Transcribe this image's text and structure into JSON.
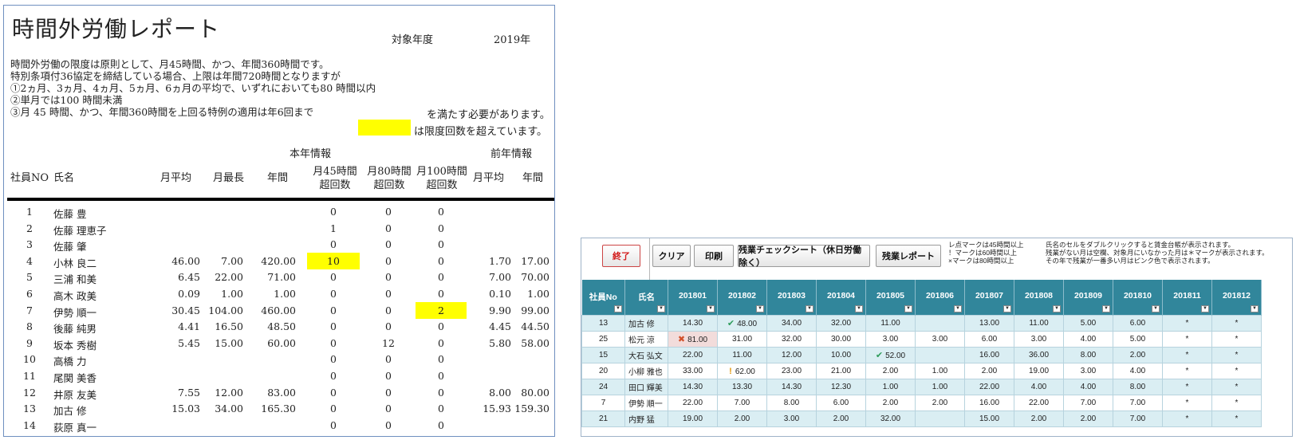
{
  "report": {
    "title": "時間外労働レポート",
    "year_label": "対象年度",
    "year": "2019年",
    "notes": [
      "時間外労働の限度は原則として、月45時間、かつ、年間360時間です。",
      "特別条項付36協定を締結している場合、上限は年間720時間となりますが",
      "①2ヵ月、3ヵ月、4ヵ月、5ヵ月、6ヵ月の平均で、いずれにおいても80 時間以内",
      "②単月では100 時間未満",
      "③月 45 時間、かつ、年間360時間を上回る特例の適用は年6回まで"
    ],
    "must_satisfy": "を満たす必要があります。",
    "over_limit_legend": "は限度回数を超えています。",
    "section_current": "本年情報",
    "section_previous": "前年情報",
    "headers": {
      "no": "社員NO",
      "name": "氏名",
      "avg": "月平均",
      "max": "月最長",
      "year": "年間",
      "m45_1": "月45時間",
      "m45_2": "超回数",
      "m80_1": "月80時間",
      "m80_2": "超回数",
      "m100_1": "月100時間",
      "m100_2": "超回数",
      "prev_avg": "月平均",
      "prev_year": "年間"
    },
    "rows": [
      {
        "no": "1",
        "name": "佐藤 豊",
        "avg": "",
        "max": "",
        "year": "",
        "m45": "0",
        "m80": "0",
        "m100": "0",
        "pavg": "",
        "pyr": ""
      },
      {
        "no": "2",
        "name": "佐藤 理恵子",
        "avg": "",
        "max": "",
        "year": "",
        "m45": "1",
        "m80": "0",
        "m100": "0",
        "pavg": "",
        "pyr": ""
      },
      {
        "no": "3",
        "name": "佐藤 肇",
        "avg": "",
        "max": "",
        "year": "",
        "m45": "0",
        "m80": "0",
        "m100": "0",
        "pavg": "",
        "pyr": ""
      },
      {
        "no": "4",
        "name": "小林 良二",
        "avg": "46.00",
        "max": "7.00",
        "year": "420.00",
        "m45": "10",
        "m80": "0",
        "m100": "0",
        "pavg": "1.70",
        "pyr": "17.00"
      },
      {
        "no": "5",
        "name": "三浦 和美",
        "avg": "6.45",
        "max": "22.00",
        "year": "71.00",
        "m45": "0",
        "m80": "0",
        "m100": "0",
        "pavg": "7.00",
        "pyr": "70.00"
      },
      {
        "no": "6",
        "name": "高木 政美",
        "avg": "0.09",
        "max": "1.00",
        "year": "1.00",
        "m45": "0",
        "m80": "0",
        "m100": "0",
        "pavg": "0.10",
        "pyr": "1.00"
      },
      {
        "no": "7",
        "name": "伊勢 順一",
        "avg": "30.45",
        "max": "104.00",
        "year": "460.00",
        "m45": "0",
        "m80": "0",
        "m100": "2",
        "pavg": "9.90",
        "pyr": "99.00"
      },
      {
        "no": "8",
        "name": "後藤 純男",
        "avg": "4.41",
        "max": "16.50",
        "year": "48.50",
        "m45": "0",
        "m80": "0",
        "m100": "0",
        "pavg": "4.45",
        "pyr": "44.50"
      },
      {
        "no": "9",
        "name": "坂本 秀樹",
        "avg": "5.45",
        "max": "15.00",
        "year": "60.00",
        "m45": "0",
        "m80": "12",
        "m100": "0",
        "pavg": "5.80",
        "pyr": "58.00"
      },
      {
        "no": "10",
        "name": "高橋 力",
        "avg": "",
        "max": "",
        "year": "",
        "m45": "0",
        "m80": "0",
        "m100": "0",
        "pavg": "",
        "pyr": ""
      },
      {
        "no": "11",
        "name": "尾関 美香",
        "avg": "",
        "max": "",
        "year": "",
        "m45": "0",
        "m80": "0",
        "m100": "0",
        "pavg": "",
        "pyr": ""
      },
      {
        "no": "12",
        "name": "井原 友美",
        "avg": "7.55",
        "max": "12.00",
        "year": "83.00",
        "m45": "0",
        "m80": "0",
        "m100": "0",
        "pavg": "8.00",
        "pyr": "80.00"
      },
      {
        "no": "13",
        "name": "加古 修",
        "avg": "15.03",
        "max": "34.00",
        "year": "165.30",
        "m45": "0",
        "m80": "0",
        "m100": "0",
        "pavg": "15.93",
        "pyr": "159.30"
      },
      {
        "no": "14",
        "name": "荻原 真一",
        "avg": "",
        "max": "",
        "year": "",
        "m45": "0",
        "m80": "0",
        "m100": "0",
        "pavg": "",
        "pyr": ""
      }
    ]
  },
  "app": {
    "buttons": {
      "exit": "終了",
      "clear": "クリア",
      "print": "印刷",
      "check_sheet": "残業チェックシート（休日労働除く）",
      "report": "残業レポート"
    },
    "legend_notes": [
      "レ点マークは45時間以上",
      "！マークは60時間以上",
      "×マークは80時間以上"
    ],
    "info_notes": [
      "氏名のセルをダブルクリックすると賃金台帳が表示されます。",
      "残業がない月は空欄、対象月にいなかった月は＊マークが表示されます。",
      "その年で残業が一番多い月はピンク色で表示されます。"
    ],
    "columns": [
      "社員No",
      "氏名",
      "201801",
      "201802",
      "201803",
      "201804",
      "201805",
      "201806",
      "201807",
      "201808",
      "201809",
      "201810",
      "201811",
      "201812"
    ],
    "rows": [
      {
        "no": "13",
        "name": "加古 修",
        "v": [
          "14.30",
          "48.00",
          "34.00",
          "32.00",
          "11.00",
          "",
          "13.00",
          "11.00",
          "5.00",
          "6.00",
          "*",
          "*"
        ]
      },
      {
        "no": "25",
        "name": "松元 涼",
        "v": [
          "81.00",
          "31.00",
          "32.00",
          "30.00",
          "3.00",
          "3.00",
          "6.00",
          "3.00",
          "4.00",
          "5.00",
          "*",
          "*"
        ]
      },
      {
        "no": "15",
        "name": "大石 弘文",
        "v": [
          "22.00",
          "11.00",
          "12.00",
          "10.00",
          "52.00",
          "",
          "16.00",
          "36.00",
          "8.00",
          "2.00",
          "*",
          "*"
        ]
      },
      {
        "no": "20",
        "name": "小柳 雅也",
        "v": [
          "33.00",
          "62.00",
          "23.00",
          "21.00",
          "2.00",
          "1.00",
          "2.00",
          "19.00",
          "3.00",
          "4.00",
          "*",
          "*"
        ]
      },
      {
        "no": "24",
        "name": "田口 輝美",
        "v": [
          "14.30",
          "13.30",
          "14.30",
          "12.30",
          "1.00",
          "1.00",
          "22.00",
          "4.00",
          "4.00",
          "8.00",
          "*",
          "*"
        ]
      },
      {
        "no": "7",
        "name": "伊勢 順一",
        "v": [
          "22.00",
          "7.00",
          "8.00",
          "6.00",
          "2.00",
          "2.00",
          "16.00",
          "22.00",
          "7.00",
          "7.00",
          "*",
          "*"
        ]
      },
      {
        "no": "21",
        "name": "内野 猛",
        "v": [
          "19.00",
          "2.00",
          "3.00",
          "2.00",
          "32.00",
          "",
          "15.00",
          "2.00",
          "2.00",
          "7.00",
          "*",
          "*"
        ]
      }
    ],
    "marks": [
      {
        "row": 0,
        "col": 1,
        "type": "check"
      },
      {
        "row": 1,
        "col": 0,
        "type": "cross"
      },
      {
        "row": 2,
        "col": 4,
        "type": "check"
      },
      {
        "row": 3,
        "col": 1,
        "type": "bang"
      }
    ],
    "pink_cells": [
      {
        "row": 1,
        "col": 0
      }
    ],
    "colors": {
      "header_bg": "#31869b",
      "row_alt": "#daeef3",
      "highlight": "#ffff00",
      "max_month": "#f2dcdb"
    }
  }
}
